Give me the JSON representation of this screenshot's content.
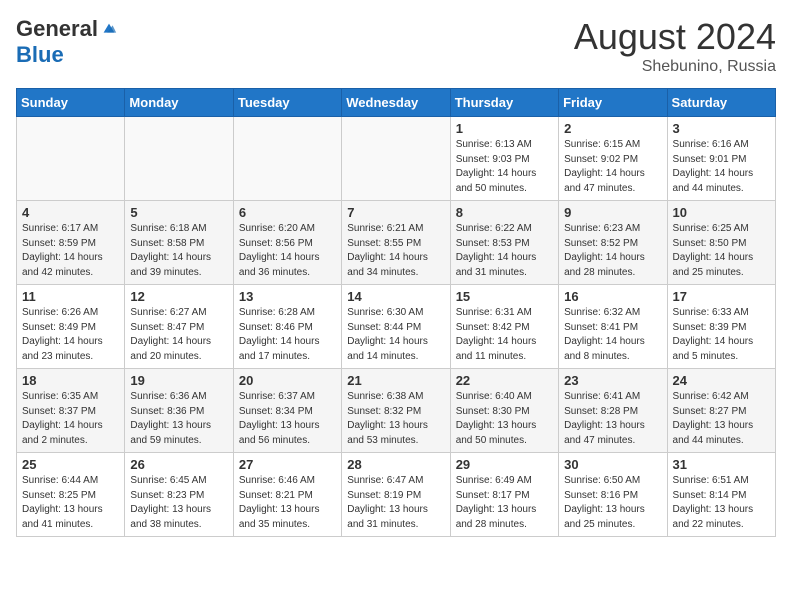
{
  "header": {
    "logo": {
      "general": "General",
      "blue": "Blue"
    },
    "title": "August 2024",
    "location": "Shebunino, Russia"
  },
  "calendar": {
    "weekdays": [
      "Sunday",
      "Monday",
      "Tuesday",
      "Wednesday",
      "Thursday",
      "Friday",
      "Saturday"
    ],
    "weeks": [
      [
        {
          "day": "",
          "info": ""
        },
        {
          "day": "",
          "info": ""
        },
        {
          "day": "",
          "info": ""
        },
        {
          "day": "",
          "info": ""
        },
        {
          "day": "1",
          "info": "Sunrise: 6:13 AM\nSunset: 9:03 PM\nDaylight: 14 hours\nand 50 minutes."
        },
        {
          "day": "2",
          "info": "Sunrise: 6:15 AM\nSunset: 9:02 PM\nDaylight: 14 hours\nand 47 minutes."
        },
        {
          "day": "3",
          "info": "Sunrise: 6:16 AM\nSunset: 9:01 PM\nDaylight: 14 hours\nand 44 minutes."
        }
      ],
      [
        {
          "day": "4",
          "info": "Sunrise: 6:17 AM\nSunset: 8:59 PM\nDaylight: 14 hours\nand 42 minutes."
        },
        {
          "day": "5",
          "info": "Sunrise: 6:18 AM\nSunset: 8:58 PM\nDaylight: 14 hours\nand 39 minutes."
        },
        {
          "day": "6",
          "info": "Sunrise: 6:20 AM\nSunset: 8:56 PM\nDaylight: 14 hours\nand 36 minutes."
        },
        {
          "day": "7",
          "info": "Sunrise: 6:21 AM\nSunset: 8:55 PM\nDaylight: 14 hours\nand 34 minutes."
        },
        {
          "day": "8",
          "info": "Sunrise: 6:22 AM\nSunset: 8:53 PM\nDaylight: 14 hours\nand 31 minutes."
        },
        {
          "day": "9",
          "info": "Sunrise: 6:23 AM\nSunset: 8:52 PM\nDaylight: 14 hours\nand 28 minutes."
        },
        {
          "day": "10",
          "info": "Sunrise: 6:25 AM\nSunset: 8:50 PM\nDaylight: 14 hours\nand 25 minutes."
        }
      ],
      [
        {
          "day": "11",
          "info": "Sunrise: 6:26 AM\nSunset: 8:49 PM\nDaylight: 14 hours\nand 23 minutes."
        },
        {
          "day": "12",
          "info": "Sunrise: 6:27 AM\nSunset: 8:47 PM\nDaylight: 14 hours\nand 20 minutes."
        },
        {
          "day": "13",
          "info": "Sunrise: 6:28 AM\nSunset: 8:46 PM\nDaylight: 14 hours\nand 17 minutes."
        },
        {
          "day": "14",
          "info": "Sunrise: 6:30 AM\nSunset: 8:44 PM\nDaylight: 14 hours\nand 14 minutes."
        },
        {
          "day": "15",
          "info": "Sunrise: 6:31 AM\nSunset: 8:42 PM\nDaylight: 14 hours\nand 11 minutes."
        },
        {
          "day": "16",
          "info": "Sunrise: 6:32 AM\nSunset: 8:41 PM\nDaylight: 14 hours\nand 8 minutes."
        },
        {
          "day": "17",
          "info": "Sunrise: 6:33 AM\nSunset: 8:39 PM\nDaylight: 14 hours\nand 5 minutes."
        }
      ],
      [
        {
          "day": "18",
          "info": "Sunrise: 6:35 AM\nSunset: 8:37 PM\nDaylight: 14 hours\nand 2 minutes."
        },
        {
          "day": "19",
          "info": "Sunrise: 6:36 AM\nSunset: 8:36 PM\nDaylight: 13 hours\nand 59 minutes."
        },
        {
          "day": "20",
          "info": "Sunrise: 6:37 AM\nSunset: 8:34 PM\nDaylight: 13 hours\nand 56 minutes."
        },
        {
          "day": "21",
          "info": "Sunrise: 6:38 AM\nSunset: 8:32 PM\nDaylight: 13 hours\nand 53 minutes."
        },
        {
          "day": "22",
          "info": "Sunrise: 6:40 AM\nSunset: 8:30 PM\nDaylight: 13 hours\nand 50 minutes."
        },
        {
          "day": "23",
          "info": "Sunrise: 6:41 AM\nSunset: 8:28 PM\nDaylight: 13 hours\nand 47 minutes."
        },
        {
          "day": "24",
          "info": "Sunrise: 6:42 AM\nSunset: 8:27 PM\nDaylight: 13 hours\nand 44 minutes."
        }
      ],
      [
        {
          "day": "25",
          "info": "Sunrise: 6:44 AM\nSunset: 8:25 PM\nDaylight: 13 hours\nand 41 minutes."
        },
        {
          "day": "26",
          "info": "Sunrise: 6:45 AM\nSunset: 8:23 PM\nDaylight: 13 hours\nand 38 minutes."
        },
        {
          "day": "27",
          "info": "Sunrise: 6:46 AM\nSunset: 8:21 PM\nDaylight: 13 hours\nand 35 minutes."
        },
        {
          "day": "28",
          "info": "Sunrise: 6:47 AM\nSunset: 8:19 PM\nDaylight: 13 hours\nand 31 minutes."
        },
        {
          "day": "29",
          "info": "Sunrise: 6:49 AM\nSunset: 8:17 PM\nDaylight: 13 hours\nand 28 minutes."
        },
        {
          "day": "30",
          "info": "Sunrise: 6:50 AM\nSunset: 8:16 PM\nDaylight: 13 hours\nand 25 minutes."
        },
        {
          "day": "31",
          "info": "Sunrise: 6:51 AM\nSunset: 8:14 PM\nDaylight: 13 hours\nand 22 minutes."
        }
      ]
    ]
  }
}
